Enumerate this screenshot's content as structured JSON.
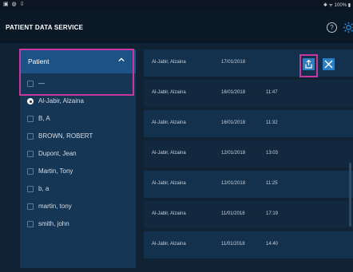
{
  "status_bar": {
    "left_icons": "▣ ◍ ⇩",
    "right_text": "✱ ᯤ 100% ▮"
  },
  "header": {
    "title": "PATIENT DATA SERVICE"
  },
  "sidebar": {
    "header_label": "Patient",
    "items": [
      {
        "label": "—",
        "selected": false
      },
      {
        "label": "Al-Jabir, Alzaina",
        "selected": true
      },
      {
        "label": "B, A",
        "selected": false
      },
      {
        "label": "BROWN, ROBERT",
        "selected": false
      },
      {
        "label": "Dupont, Jean",
        "selected": false
      },
      {
        "label": "Martin, Tony",
        "selected": false
      },
      {
        "label": "b, a",
        "selected": false
      },
      {
        "label": "martin, tony",
        "selected": false
      },
      {
        "label": "smith, john",
        "selected": false
      }
    ]
  },
  "records": [
    {
      "name": "Al-Jabir, Alzaina",
      "date": "17/01/2018",
      "time": ""
    },
    {
      "name": "Al-Jabir, Alzaina",
      "date": "16/01/2018",
      "time": "11:47"
    },
    {
      "name": "Al-Jabir, Alzaina",
      "date": "16/01/2018",
      "time": "11:32"
    },
    {
      "name": "Al-Jabir, Alzaina",
      "date": "12/01/2018",
      "time": "13:03"
    },
    {
      "name": "Al-Jabir, Alzaina",
      "date": "12/01/2018",
      "time": "11:25"
    },
    {
      "name": "Al-Jabir, Alzaina",
      "date": "11/01/2018",
      "time": "17:19"
    },
    {
      "name": "Al-Jabir, Alzaina",
      "date": "11/01/2018",
      "time": "14:40"
    }
  ],
  "colors": {
    "accent": "#2a7fc4",
    "highlight": "#c8379f",
    "background": "#0f2335"
  }
}
